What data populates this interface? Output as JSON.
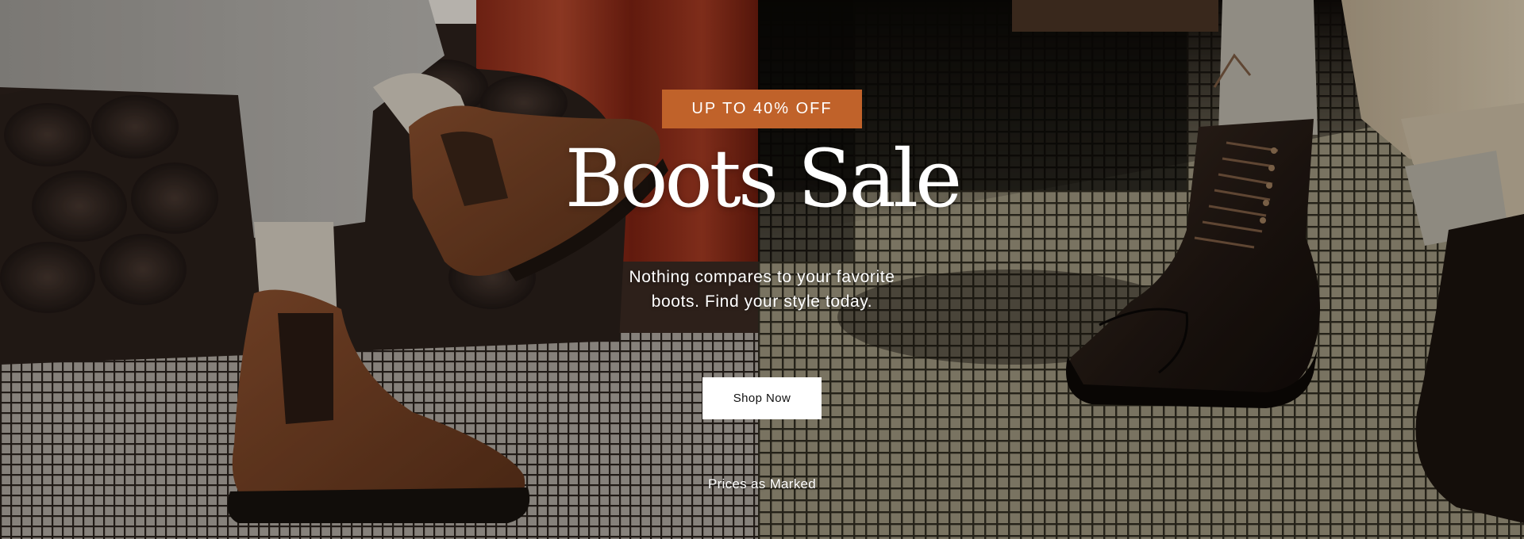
{
  "hero": {
    "badge": "UP TO 40% OFF",
    "title": "Boots Sale",
    "subtitle_line1": "Nothing compares to your favorite",
    "subtitle_line2": "boots. Find your style today.",
    "cta_label": "Shop Now",
    "fineprint": "Prices as Marked"
  },
  "colors": {
    "badge_bg": "#c0622a",
    "cta_bg": "#ffffff",
    "text": "#ffffff"
  },
  "images": {
    "left": "chelsea-boots-photo",
    "right": "lace-up-cap-toe-boot-photo"
  }
}
